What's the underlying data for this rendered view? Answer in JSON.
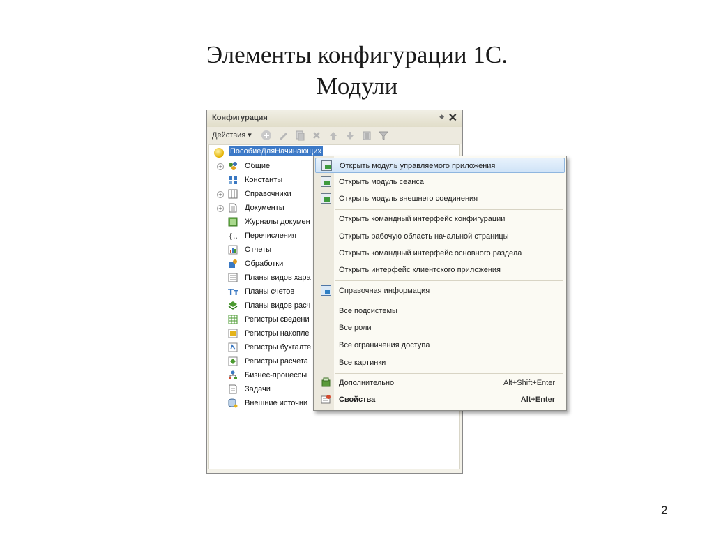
{
  "slide": {
    "title_line1": "Элементы конфигурации 1С.",
    "title_line2": "Модули",
    "page_number": "2"
  },
  "window": {
    "title": "Конфигурация",
    "pin_glyph": "◆",
    "close_glyph": "✕",
    "actions_label": "Действия ▾",
    "toolbar_icons": [
      "add-icon",
      "edit-icon",
      "copy-icon",
      "delete-icon",
      "move-up-icon",
      "move-down-icon",
      "list-icon",
      "filter-icon"
    ]
  },
  "tree": {
    "root": "ПособиеДляНачинающих",
    "items": [
      {
        "label": "Общие",
        "expandable": true,
        "icon": "common-icon"
      },
      {
        "label": "Константы",
        "expandable": false,
        "icon": "constants-icon"
      },
      {
        "label": "Справочники",
        "expandable": true,
        "icon": "catalogs-icon"
      },
      {
        "label": "Документы",
        "expandable": true,
        "icon": "documents-icon"
      },
      {
        "label": "Журналы докумен",
        "expandable": false,
        "icon": "journals-icon"
      },
      {
        "label": "Перечисления",
        "expandable": false,
        "icon": "enums-icon"
      },
      {
        "label": "Отчеты",
        "expandable": false,
        "icon": "reports-icon"
      },
      {
        "label": "Обработки",
        "expandable": false,
        "icon": "data-processors-icon"
      },
      {
        "label": "Планы видов хара",
        "expandable": false,
        "icon": "chart-of-char-types-icon"
      },
      {
        "label": "Планы счетов",
        "expandable": false,
        "icon": "chart-of-accounts-icon"
      },
      {
        "label": "Планы видов расч",
        "expandable": false,
        "icon": "chart-of-calc-types-icon"
      },
      {
        "label": "Регистры сведени",
        "expandable": false,
        "icon": "info-registers-icon"
      },
      {
        "label": "Регистры накопле",
        "expandable": false,
        "icon": "accum-registers-icon"
      },
      {
        "label": "Регистры бухгалте",
        "expandable": false,
        "icon": "accounting-registers-icon"
      },
      {
        "label": "Регистры расчета",
        "expandable": false,
        "icon": "calc-registers-icon"
      },
      {
        "label": "Бизнес-процессы",
        "expandable": false,
        "icon": "business-processes-icon"
      },
      {
        "label": "Задачи",
        "expandable": false,
        "icon": "tasks-icon"
      },
      {
        "label": "Внешние источни",
        "expandable": false,
        "icon": "external-sources-icon"
      }
    ]
  },
  "context_menu": {
    "items": [
      {
        "label": "Открыть модуль управляемого приложения",
        "icon": "module-icon",
        "selected": true
      },
      {
        "label": "Открыть модуль сеанса",
        "icon": "module-icon"
      },
      {
        "label": "Открыть модуль внешнего соединения",
        "icon": "module-icon"
      },
      {
        "separator": true
      },
      {
        "label": "Открыть командный интерфейс конфигурации"
      },
      {
        "label": "Открыть рабочую область начальной страницы"
      },
      {
        "label": "Открыть командный интерфейс основного раздела"
      },
      {
        "label": "Открыть интерфейс клиентского приложения"
      },
      {
        "separator": true
      },
      {
        "label": "Справочная информация",
        "icon": "help-info-icon"
      },
      {
        "separator": true
      },
      {
        "label": "Все подсистемы"
      },
      {
        "label": "Все роли"
      },
      {
        "label": "Все ограничения доступа"
      },
      {
        "label": "Все картинки"
      },
      {
        "separator": true
      },
      {
        "label": "Дополнительно",
        "icon": "additional-icon",
        "shortcut": "Alt+Shift+Enter"
      },
      {
        "label": "Свойства",
        "icon": "properties-icon",
        "shortcut": "Alt+Enter",
        "bold": true
      }
    ]
  },
  "colors": {
    "selection": "#3c79c7",
    "menu_background": "#fbfaf3",
    "window_background": "#f3f1e8"
  }
}
